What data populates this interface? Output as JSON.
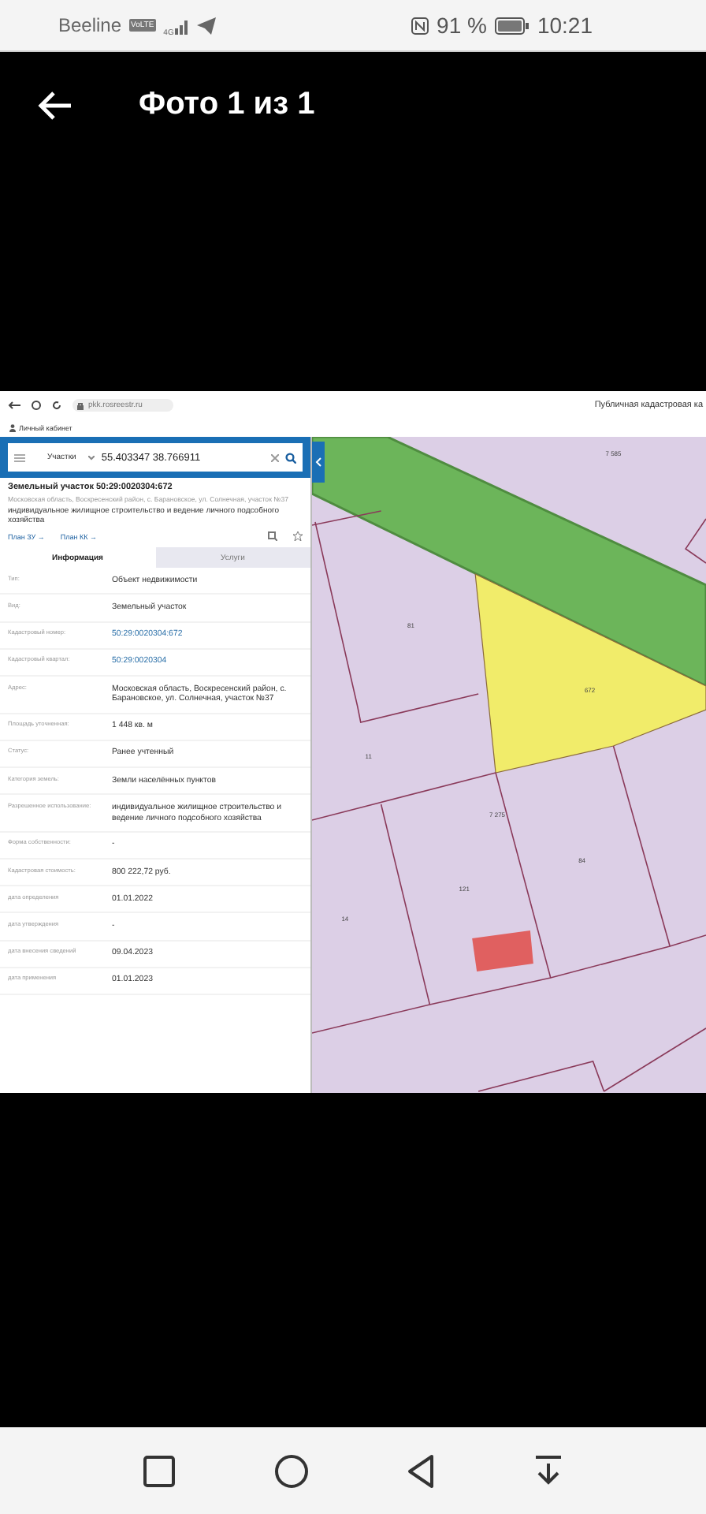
{
  "status_bar": {
    "carrier": "Beeline",
    "volte": "VoLTE",
    "network": "4G",
    "battery": "91 %",
    "time": "10:21"
  },
  "app_bar": {
    "title": "Фото 1 из 1"
  },
  "browser": {
    "url": "pkk.rosreestr.ru",
    "site_title": "Публичная кадастровая ка",
    "account_link": "Личный кабинет"
  },
  "search": {
    "category": "Участки",
    "value": "55.403347 38.766911"
  },
  "parcel": {
    "title": "Земельный участок 50:29:0020304:672",
    "address": "Московская область, Воскресенский район, с. Барановское, ул. Солнечная, участок №37",
    "use": "индивидуальное жилищное строительство и ведение личного подсобного хозяйства",
    "links": [
      "План ЗУ →",
      "План КК →"
    ]
  },
  "tabs": [
    {
      "label": "Информация",
      "selected": true
    },
    {
      "label": "Услуги",
      "selected": false
    }
  ],
  "rows": [
    {
      "label": "Тип:",
      "value": "Объект недвижимости",
      "kind": "text"
    },
    {
      "label": "Вид:",
      "value": "Земельный участок",
      "kind": "text"
    },
    {
      "label": "Кадастровый номер:",
      "value": "50:29:0020304:672",
      "kind": "link"
    },
    {
      "label": "Кадастровый квартал:",
      "value": "50:29:0020304",
      "kind": "link"
    },
    {
      "label": "Адрес:",
      "value": "Московская область, Воскресенский район, с. Барановское, ул. Солнечная, участок №37",
      "kind": "text"
    },
    {
      "label": "Площадь уточненная:",
      "value": "1 448 кв. м",
      "kind": "text"
    },
    {
      "label": "Статус:",
      "value": "Ранее учтенный",
      "kind": "text"
    },
    {
      "label": "Категория земель:",
      "value": "Земли населённых пунктов",
      "kind": "text"
    },
    {
      "label": "Разрешенное использование:",
      "value": "индивидуальное жилищное строительство и ведение личного подсобного хозяйства",
      "kind": "text"
    },
    {
      "label": "Форма собственности:",
      "value": "-",
      "kind": "text"
    },
    {
      "label": "Кадастровая стоимость:",
      "value": "800 222,72 руб.",
      "kind": "text"
    },
    {
      "label": "дата определения",
      "value": "01.01.2022",
      "kind": "text"
    },
    {
      "label": "дата утверждения",
      "value": "-",
      "kind": "text"
    },
    {
      "label": "дата внесения сведений",
      "value": "09.04.2023",
      "kind": "text"
    },
    {
      "label": "дата применения",
      "value": "01.01.2023",
      "kind": "text"
    }
  ],
  "map": {
    "labels": [
      "7 585",
      "81",
      "672",
      "11",
      "7 275",
      "121",
      "84",
      "14"
    ]
  }
}
